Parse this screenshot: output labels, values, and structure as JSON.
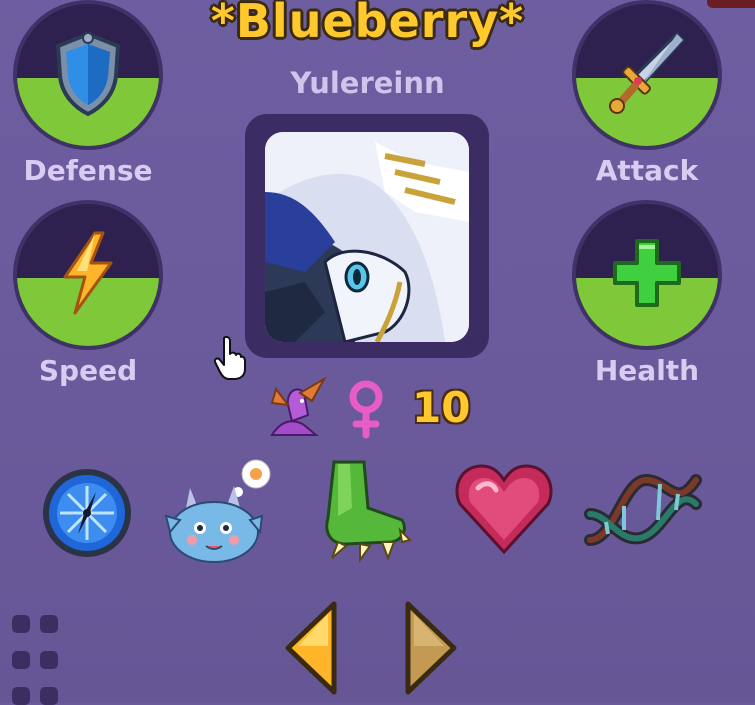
{
  "pet": {
    "name": "*Blueberry*",
    "species": "Yulereinn",
    "level": "10",
    "gender_icon": "female-symbol-icon",
    "type_icon": "purple-dragon-icon"
  },
  "stats": [
    {
      "label": "Defense",
      "icon": "shield-icon",
      "fill": 0.48
    },
    {
      "label": "Attack",
      "icon": "sword-icon",
      "fill": 0.48
    },
    {
      "label": "Speed",
      "icon": "lightning-icon",
      "fill": 0.48
    },
    {
      "label": "Health",
      "icon": "plus-icon",
      "fill": 0.48
    }
  ],
  "traits": [
    {
      "name": "frost-compass-icon"
    },
    {
      "name": "baby-dragon-thinking-icon"
    },
    {
      "name": "green-claw-icon"
    },
    {
      "name": "pink-heart-gem-icon"
    },
    {
      "name": "dna-helix-icon"
    }
  ],
  "navigation": {
    "prev_icon": "arrow-left-icon",
    "next_icon": "arrow-right-icon",
    "menu_icon": "grid-menu-icon"
  },
  "colors": {
    "background": "#6a5a9c",
    "accent_gold": "#ffc92e",
    "stat_fill_green": "#7fc83a"
  }
}
